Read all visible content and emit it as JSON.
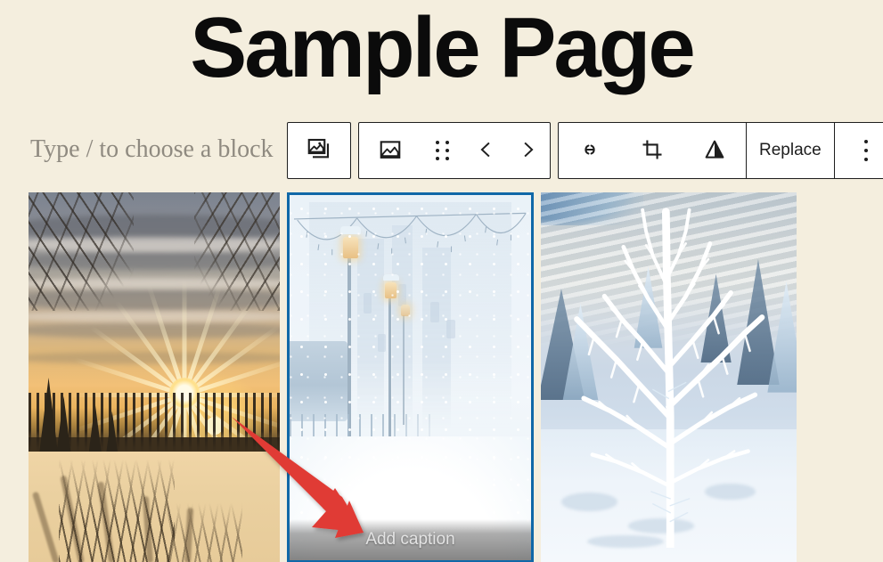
{
  "page": {
    "title": "Sample Page",
    "background_color": "#f4eede",
    "title_color": "#0b0b0b"
  },
  "editor": {
    "block_placeholder": "Type / to choose a block",
    "placeholder_color": "#8f8a80",
    "selection_color": "#1068a8",
    "annotation_color": "#e03b34"
  },
  "toolbar": {
    "parent_block": {
      "icon": "gallery-icon",
      "label": "Gallery"
    },
    "block_type": {
      "icon": "image-icon",
      "label": "Image"
    },
    "drag_handle": {
      "icon": "drag-dots-icon",
      "label": "Drag"
    },
    "move_left": {
      "icon": "chevron-left-icon",
      "label": "Move left"
    },
    "move_right": {
      "icon": "chevron-right-icon",
      "label": "Move right"
    },
    "link": {
      "icon": "link-icon",
      "label": "Insert link"
    },
    "crop": {
      "icon": "crop-icon",
      "label": "Crop"
    },
    "duotone": {
      "icon": "duotone-filter-icon",
      "label": "Apply duotone filter"
    },
    "replace_label": "Replace",
    "more_options": {
      "icon": "more-vertical-icon",
      "label": "Options"
    }
  },
  "gallery": {
    "images": [
      {
        "name": "winter-sunset-frozen-lake",
        "alt": "Sunset over a frozen lake with bare trees and snow",
        "selected": false,
        "caption": ""
      },
      {
        "name": "snowy-street-lamps",
        "alt": "Heavy snowfall on a street with lamp posts and parked bicycles",
        "selected": true,
        "caption_placeholder": "Add caption"
      },
      {
        "name": "frost-covered-tree",
        "alt": "Frost covered tree in a snowy landscape",
        "selected": false,
        "caption": ""
      }
    ]
  }
}
